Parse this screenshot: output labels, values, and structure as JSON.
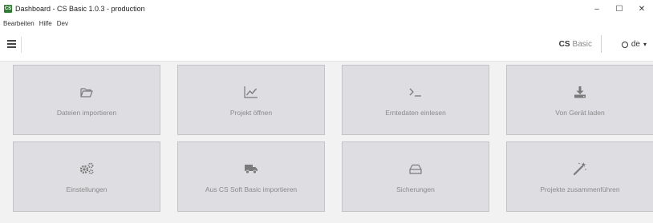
{
  "window": {
    "title": "Dashboard - CS Basic 1.0.3 - production",
    "controls": [
      "–",
      "☐",
      "✕"
    ]
  },
  "menubar": {
    "items": [
      "Bearbeiten",
      "Hilfe",
      "Dev"
    ]
  },
  "toolbar": {
    "brand_bold": "CS",
    "brand_sub": "Basic",
    "language": "de",
    "icons": [
      "menu-icon",
      "globe-icon",
      "caret-down-icon"
    ]
  },
  "tiles": [
    {
      "label": "Dateien importieren",
      "icon": "folder-open-icon"
    },
    {
      "label": "Projekt öffnen",
      "icon": "line-chart-icon"
    },
    {
      "label": "Erntedaten einlesen",
      "icon": "terminal-icon"
    },
    {
      "label": "Von Gerät laden",
      "icon": "download-icon"
    },
    {
      "label": "Einstellungen",
      "icon": "gears-icon"
    },
    {
      "label": "Aus CS Soft Basic importieren",
      "icon": "truck-icon"
    },
    {
      "label": "Sicherungen",
      "icon": "hdd-icon"
    },
    {
      "label": "Projekte zusammenführen",
      "icon": "magic-wand-icon"
    }
  ],
  "colors": {
    "tile_bg": "#dedde1",
    "tile_border": "#c4c3c8",
    "app_icon": "#2e7d32"
  }
}
